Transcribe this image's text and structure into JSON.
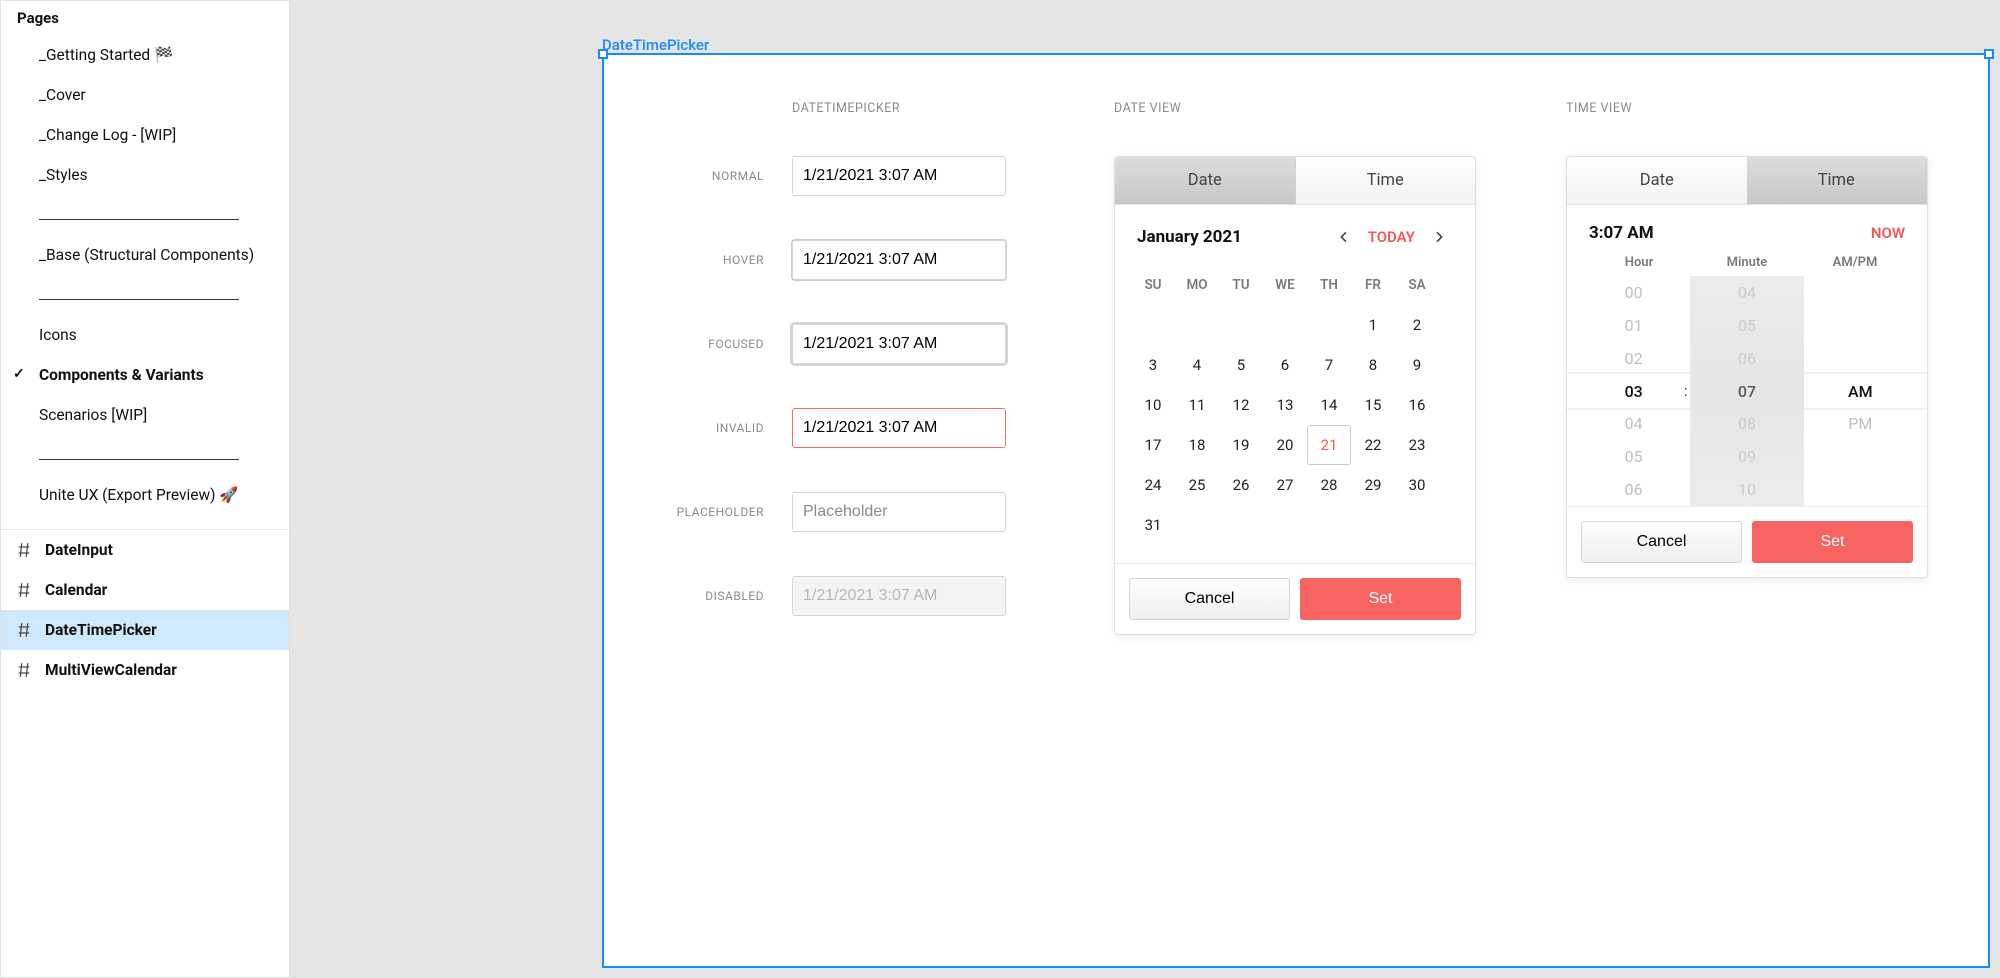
{
  "sidebar": {
    "title": "Pages",
    "pages": [
      {
        "label": "_Getting Started 🏁"
      },
      {
        "label": "_Cover"
      },
      {
        "label": "_Change Log - [WIP]"
      },
      {
        "label": "_Styles"
      },
      {
        "divider": true
      },
      {
        "label": "_Base (Structural Components)"
      },
      {
        "divider": true
      },
      {
        "label": "Icons"
      },
      {
        "label": "Components & Variants",
        "checked": true
      },
      {
        "label": "Scenarios [WIP]"
      },
      {
        "divider": true
      },
      {
        "label": "Unite UX (Export Preview) 🚀"
      }
    ],
    "frames": [
      {
        "label": "DateInput"
      },
      {
        "label": "Calendar"
      },
      {
        "label": "DateTimePicker",
        "selected": true
      },
      {
        "label": "MultiViewCalendar"
      }
    ]
  },
  "frameLabel": "DateTimePicker",
  "columns": {
    "variants": {
      "title": "DATETIMEPICKER",
      "rows": [
        {
          "label": "NORMAL",
          "value": "1/21/2021 3:07 AM",
          "state": ""
        },
        {
          "label": "HOVER",
          "value": "1/21/2021 3:07 AM",
          "state": "hov"
        },
        {
          "label": "FOCUSED",
          "value": "1/21/2021 3:07 AM",
          "state": "foc"
        },
        {
          "label": "INVALID",
          "value": "1/21/2021 3:07 AM",
          "state": "inv"
        },
        {
          "label": "PLACEHOLDER",
          "placeholder": "Placeholder",
          "state": ""
        },
        {
          "label": "DISABLED",
          "value": "1/21/2021 3:07 AM",
          "state": "dis"
        }
      ]
    },
    "dateView": {
      "title": "DATE VIEW",
      "tabs": {
        "date": "Date",
        "time": "Time"
      },
      "header": {
        "monthYear": "January 2021",
        "today": "TODAY"
      },
      "weekdays": [
        "SU",
        "MO",
        "TU",
        "WE",
        "TH",
        "FR",
        "SA"
      ],
      "weeks": [
        [
          "",
          "",
          "",
          "",
          "",
          "1",
          "2"
        ],
        [
          "3",
          "4",
          "5",
          "6",
          "7",
          "8",
          "9"
        ],
        [
          "10",
          "11",
          "12",
          "13",
          "14",
          "15",
          "16"
        ],
        [
          "17",
          "18",
          "19",
          "20",
          "21",
          "22",
          "23"
        ],
        [
          "24",
          "25",
          "26",
          "27",
          "28",
          "29",
          "30"
        ],
        [
          "31",
          "",
          "",
          "",
          "",
          "",
          ""
        ]
      ],
      "todayDay": "21",
      "footer": {
        "cancel": "Cancel",
        "set": "Set"
      }
    },
    "timeView": {
      "title": "TIME VIEW",
      "tabs": {
        "date": "Date",
        "time": "Time"
      },
      "header": {
        "time": "3:07 AM",
        "now": "NOW"
      },
      "spinLabels": {
        "hour": "Hour",
        "minute": "Minute",
        "ampm": "AM/PM"
      },
      "hours": [
        "00",
        "01",
        "02",
        "03",
        "04",
        "05",
        "06"
      ],
      "minutes": [
        "04",
        "05",
        "06",
        "07",
        "08",
        "09",
        "10"
      ],
      "ampm": [
        "",
        "",
        "",
        "AM",
        "PM",
        "",
        ""
      ],
      "selected": {
        "hour": "03",
        "minute": "07",
        "ampm": "AM"
      },
      "footer": {
        "cancel": "Cancel",
        "set": "Set"
      }
    }
  }
}
